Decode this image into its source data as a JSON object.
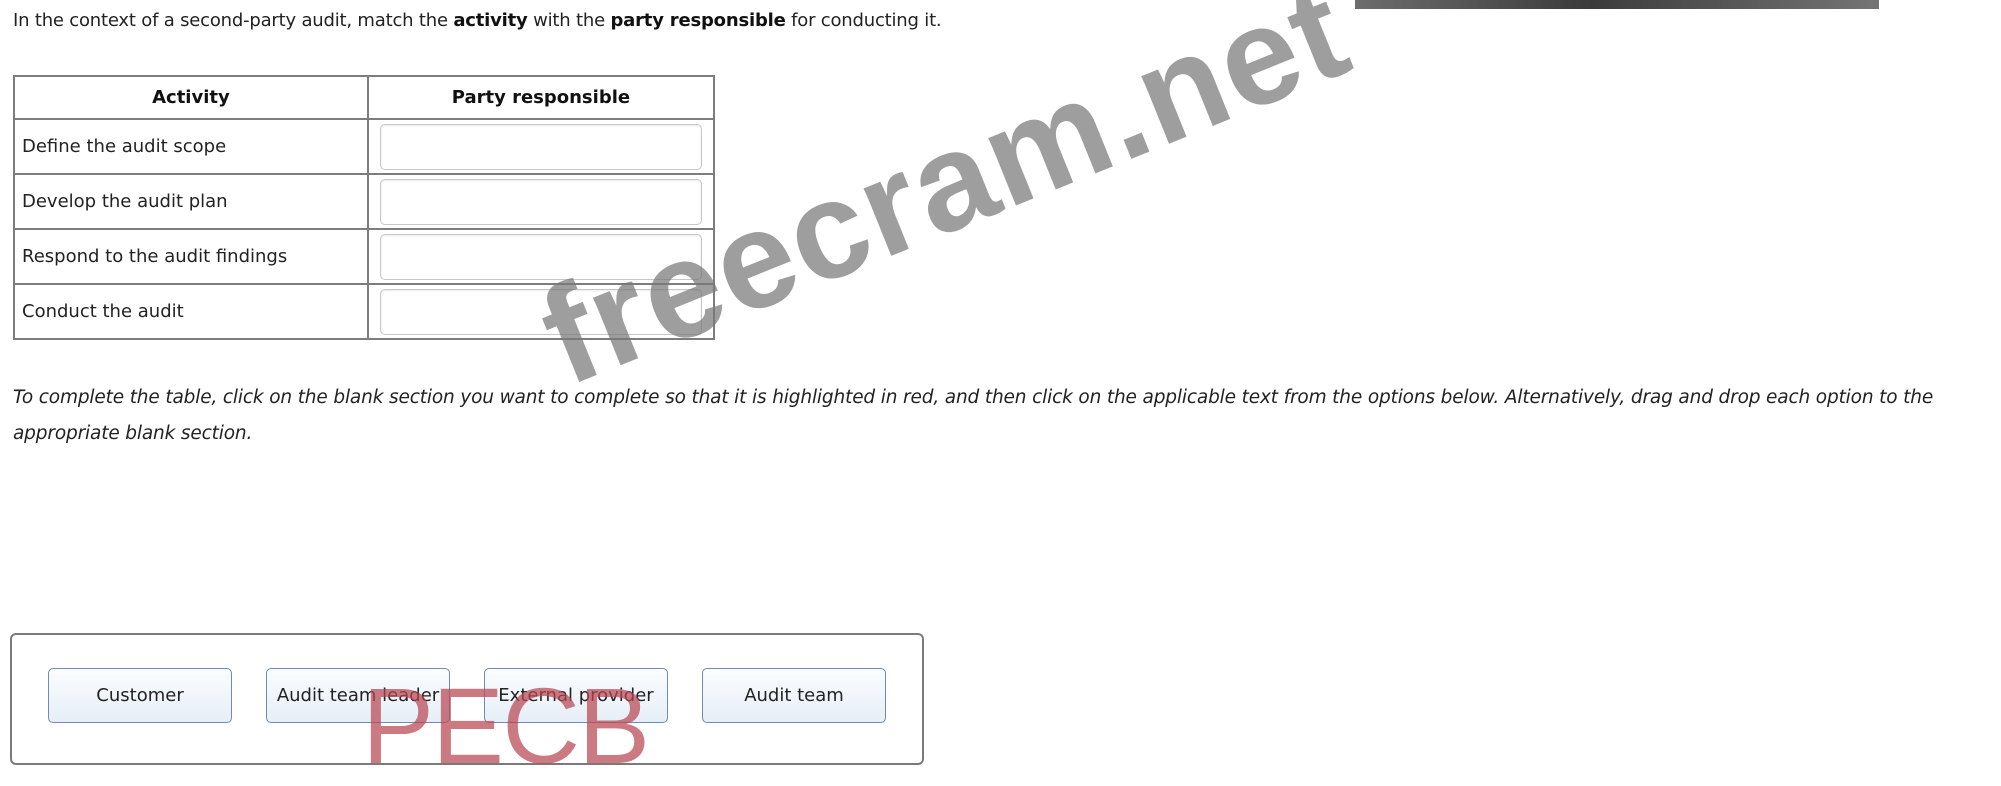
{
  "question": {
    "prefix": "In the context of a second-party audit, match the ",
    "bold1": "activity",
    "middle": " with the ",
    "bold2": "party responsible",
    "suffix": " for conducting it."
  },
  "table": {
    "headers": {
      "activity": "Activity",
      "party": "Party responsible"
    },
    "rows": [
      {
        "activity": "Define the audit scope",
        "answer": ""
      },
      {
        "activity": "Develop the audit plan",
        "answer": ""
      },
      {
        "activity": "Respond to the audit findings",
        "answer": ""
      },
      {
        "activity": "Conduct the audit",
        "answer": ""
      }
    ]
  },
  "instructions": "To complete the table, click on the blank section you want to complete so that it is highlighted in red, and then click on the applicable text from the options below. Alternatively, drag and drop each option to the appropriate blank section.",
  "options": [
    "Customer",
    "Audit team leader",
    "External provider",
    "Audit team"
  ],
  "watermark": "freecram.net",
  "logo": "PECB"
}
